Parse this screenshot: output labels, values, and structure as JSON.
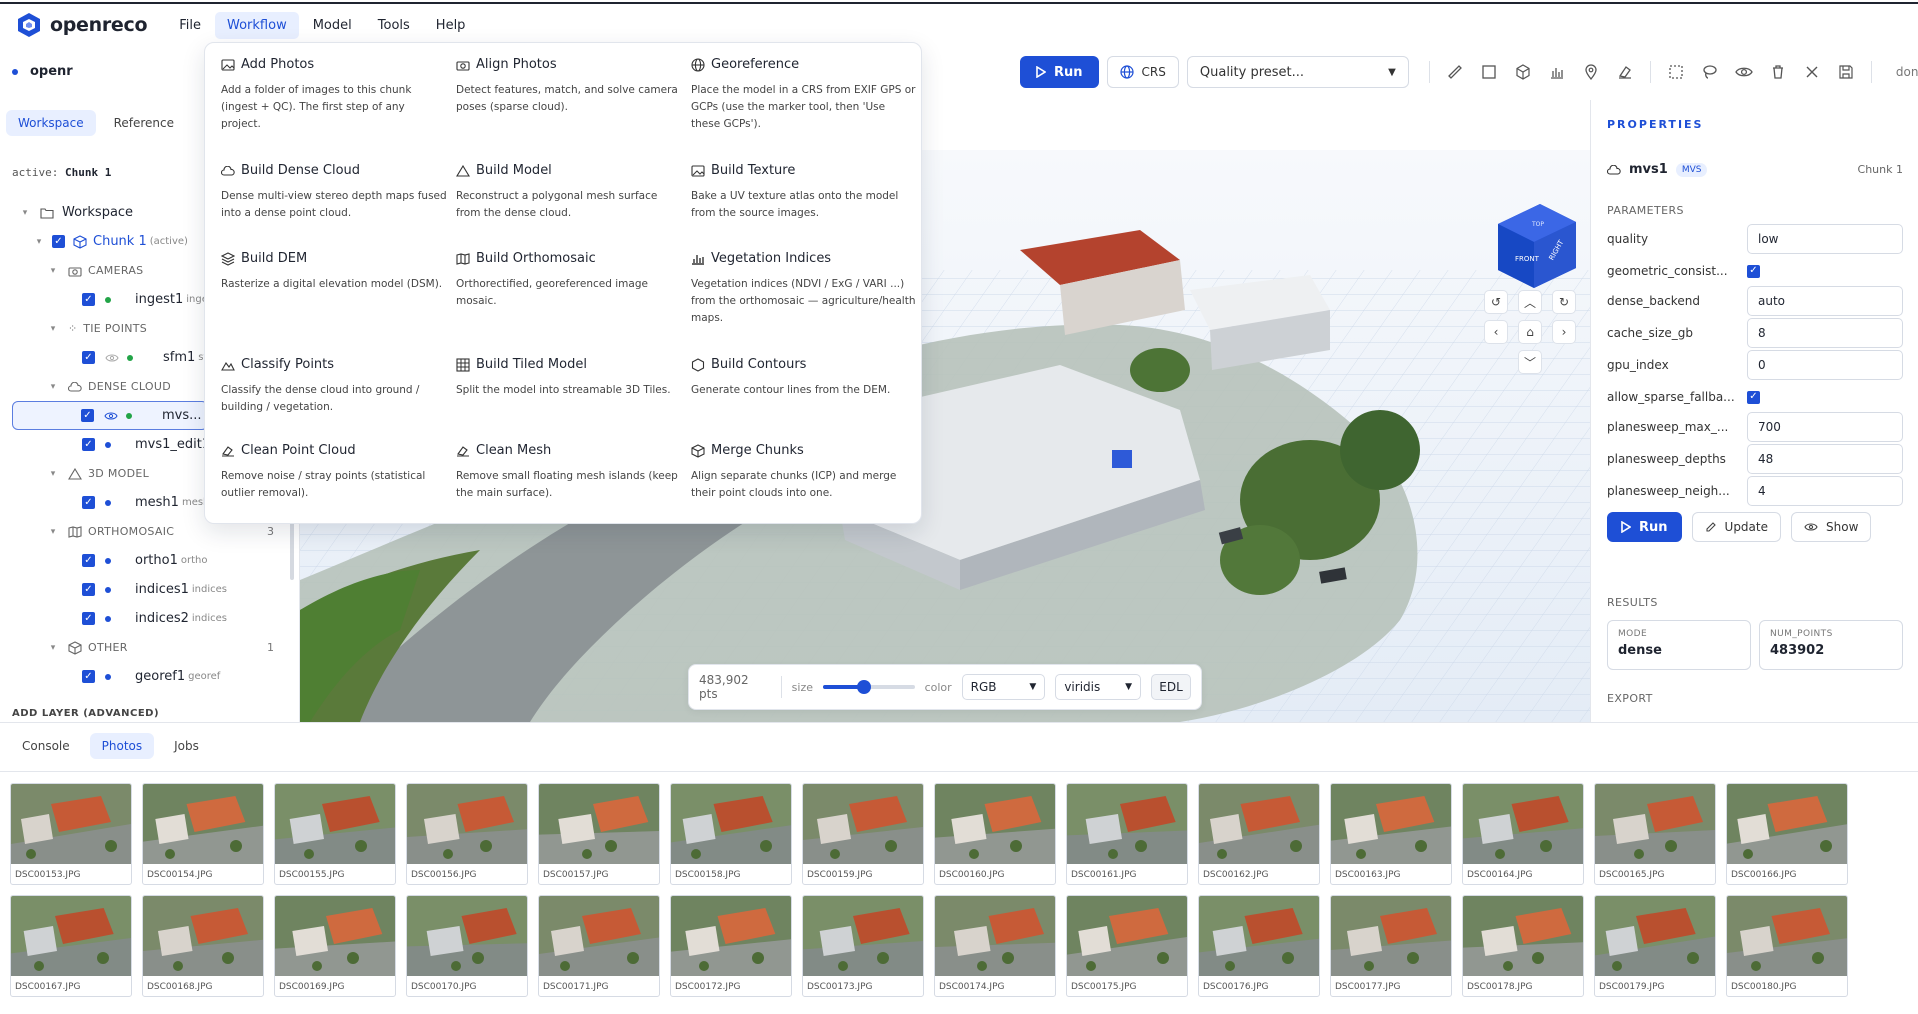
{
  "app": {
    "brand": "openreco"
  },
  "menubar": [
    "File",
    "Workflow",
    "Model",
    "Tools",
    "Help"
  ],
  "toolbar": {
    "project": "openr",
    "run": "Run",
    "crs": "CRS",
    "quality_placeholder": "Quality preset...",
    "done": "done"
  },
  "left": {
    "tabs": [
      "Workspace",
      "Reference"
    ],
    "active_label": "active:",
    "active_chunk": "Chunk 1",
    "add_layer": "ADD LAYER (ADVANCED)",
    "tree": {
      "workspace": "Workspace",
      "chunk": "Chunk 1",
      "chunk_tag": "(active)",
      "cameras": "CAMERAS",
      "ingest": "ingest1",
      "ingest_sub": "ingest",
      "tie_points": "TIE POINTS",
      "sfm": "sfm1",
      "sfm_sub": "sfm",
      "dense_cloud": "DENSE CLOUD",
      "mvs": "mvs...",
      "mvs_edit": "mvs1_edit1",
      "model": "3D MODEL",
      "mesh": "mesh1",
      "mesh_sub": "mesh",
      "ortho": "ORTHOMOSAIC",
      "ortho_count": "3",
      "ortho1": "ortho1",
      "ortho1_sub": "ortho",
      "indices1": "indices1",
      "indices1_sub": "indices",
      "indices2": "indices2",
      "indices2_sub": "indices",
      "other": "OTHER",
      "other_count": "1",
      "georef": "georef1",
      "georef_sub": "georef"
    }
  },
  "workflow_menu": [
    {
      "title": "Add Photos",
      "desc": "Add a folder of images to this chunk (ingest + QC). The first step of any project.",
      "icon": "image-icon"
    },
    {
      "title": "Align Photos",
      "desc": "Detect features, match, and solve camera poses (sparse cloud).",
      "icon": "camera-icon"
    },
    {
      "title": "Georeference",
      "desc": "Place the model in a CRS from EXIF GPS or GCPs (use the marker tool, then 'Use these GCPs').",
      "icon": "globe-icon"
    },
    {
      "title": "Build Dense Cloud",
      "desc": "Dense multi-view stereo depth maps fused into a dense point cloud.",
      "icon": "cloud-icon"
    },
    {
      "title": "Build Model",
      "desc": "Reconstruct a polygonal mesh surface from the dense cloud.",
      "icon": "triangle-icon"
    },
    {
      "title": "Build Texture",
      "desc": "Bake a UV texture atlas onto the model from the source images.",
      "icon": "texture-icon"
    },
    {
      "title": "Build DEM",
      "desc": "Rasterize a digital elevation model (DSM).",
      "icon": "layers-icon"
    },
    {
      "title": "Build Orthomosaic",
      "desc": "Orthorectified, georeferenced image mosaic.",
      "icon": "map-icon"
    },
    {
      "title": "Vegetation Indices",
      "desc": "Vegetation indices (NDVI / ExG / VARI ...) from the orthomosaic — agriculture/health maps.",
      "icon": "bars-icon"
    },
    {
      "title": "Classify Points",
      "desc": "Classify the dense cloud into ground / building / vegetation.",
      "icon": "mountain-icon"
    },
    {
      "title": "Build Tiled Model",
      "desc": "Split the model into streamable 3D Tiles.",
      "icon": "grid-icon"
    },
    {
      "title": "Build Contours",
      "desc": "Generate contour lines from the DEM.",
      "icon": "hexagon-icon"
    },
    {
      "title": "Clean Point Cloud",
      "desc": "Remove noise / stray points (statistical outlier removal).",
      "icon": "eraser-icon"
    },
    {
      "title": "Clean Mesh",
      "desc": "Remove small floating mesh islands (keep the main surface).",
      "icon": "eraser-icon"
    },
    {
      "title": "Merge Chunks",
      "desc": "Align separate chunks (ICP) and merge their point clouds into one.",
      "icon": "merge-icon"
    }
  ],
  "viewport": {
    "cube_front": "FRONT",
    "cube_right": "RIGHT",
    "cube_top": "TOP",
    "pts": "483,902 pts",
    "size_label": "size",
    "size_value": 0.45,
    "color_label": "color",
    "color_mode": "RGB",
    "colormap": "viridis",
    "edl": "EDL"
  },
  "properties": {
    "title": "PROPERTIES",
    "node": "mvs1",
    "badge": "MVS",
    "chunk": "Chunk 1",
    "parameters_label": "PARAMETERS",
    "params": [
      {
        "name": "quality",
        "value": "low"
      },
      {
        "name": "geometric_consist...",
        "value": ""
      },
      {
        "name": "dense_backend",
        "value": "auto"
      },
      {
        "name": "cache_size_gb",
        "value": "8"
      },
      {
        "name": "gpu_index",
        "value": "0"
      },
      {
        "name": "allow_sparse_fallba...",
        "value": ""
      },
      {
        "name": "planesweep_max_...",
        "value": "700"
      },
      {
        "name": "planesweep_depths",
        "value": "48"
      },
      {
        "name": "planesweep_neigh...",
        "value": "4"
      }
    ],
    "run": "Run",
    "update": "Update",
    "show": "Show",
    "results_label": "RESULTS",
    "mode_key": "MODE",
    "mode_val": "dense",
    "points_key": "NUM_POINTS",
    "points_val": "483902",
    "export_label": "EXPORT"
  },
  "bottom": {
    "tabs": [
      "Console",
      "Photos",
      "Jobs"
    ],
    "photos": [
      "DSC00153.JPG",
      "DSC00154.JPG",
      "DSC00155.JPG",
      "DSC00156.JPG",
      "DSC00157.JPG",
      "DSC00158.JPG",
      "DSC00159.JPG",
      "DSC00160.JPG",
      "DSC00161.JPG",
      "DSC00162.JPG",
      "DSC00163.JPG",
      "DSC00164.JPG",
      "DSC00165.JPG",
      "DSC00166.JPG",
      "DSC00167.JPG",
      "DSC00168.JPG",
      "DSC00169.JPG",
      "DSC00170.JPG",
      "DSC00171.JPG",
      "DSC00172.JPG",
      "DSC00173.JPG",
      "DSC00174.JPG",
      "DSC00175.JPG",
      "DSC00176.JPG",
      "DSC00177.JPG",
      "DSC00178.JPG",
      "DSC00179.JPG",
      "DSC00180.JPG"
    ]
  },
  "colors": {
    "accent": "#1e4fd6",
    "accent_soft": "#e8efff",
    "green": "#22a447"
  }
}
